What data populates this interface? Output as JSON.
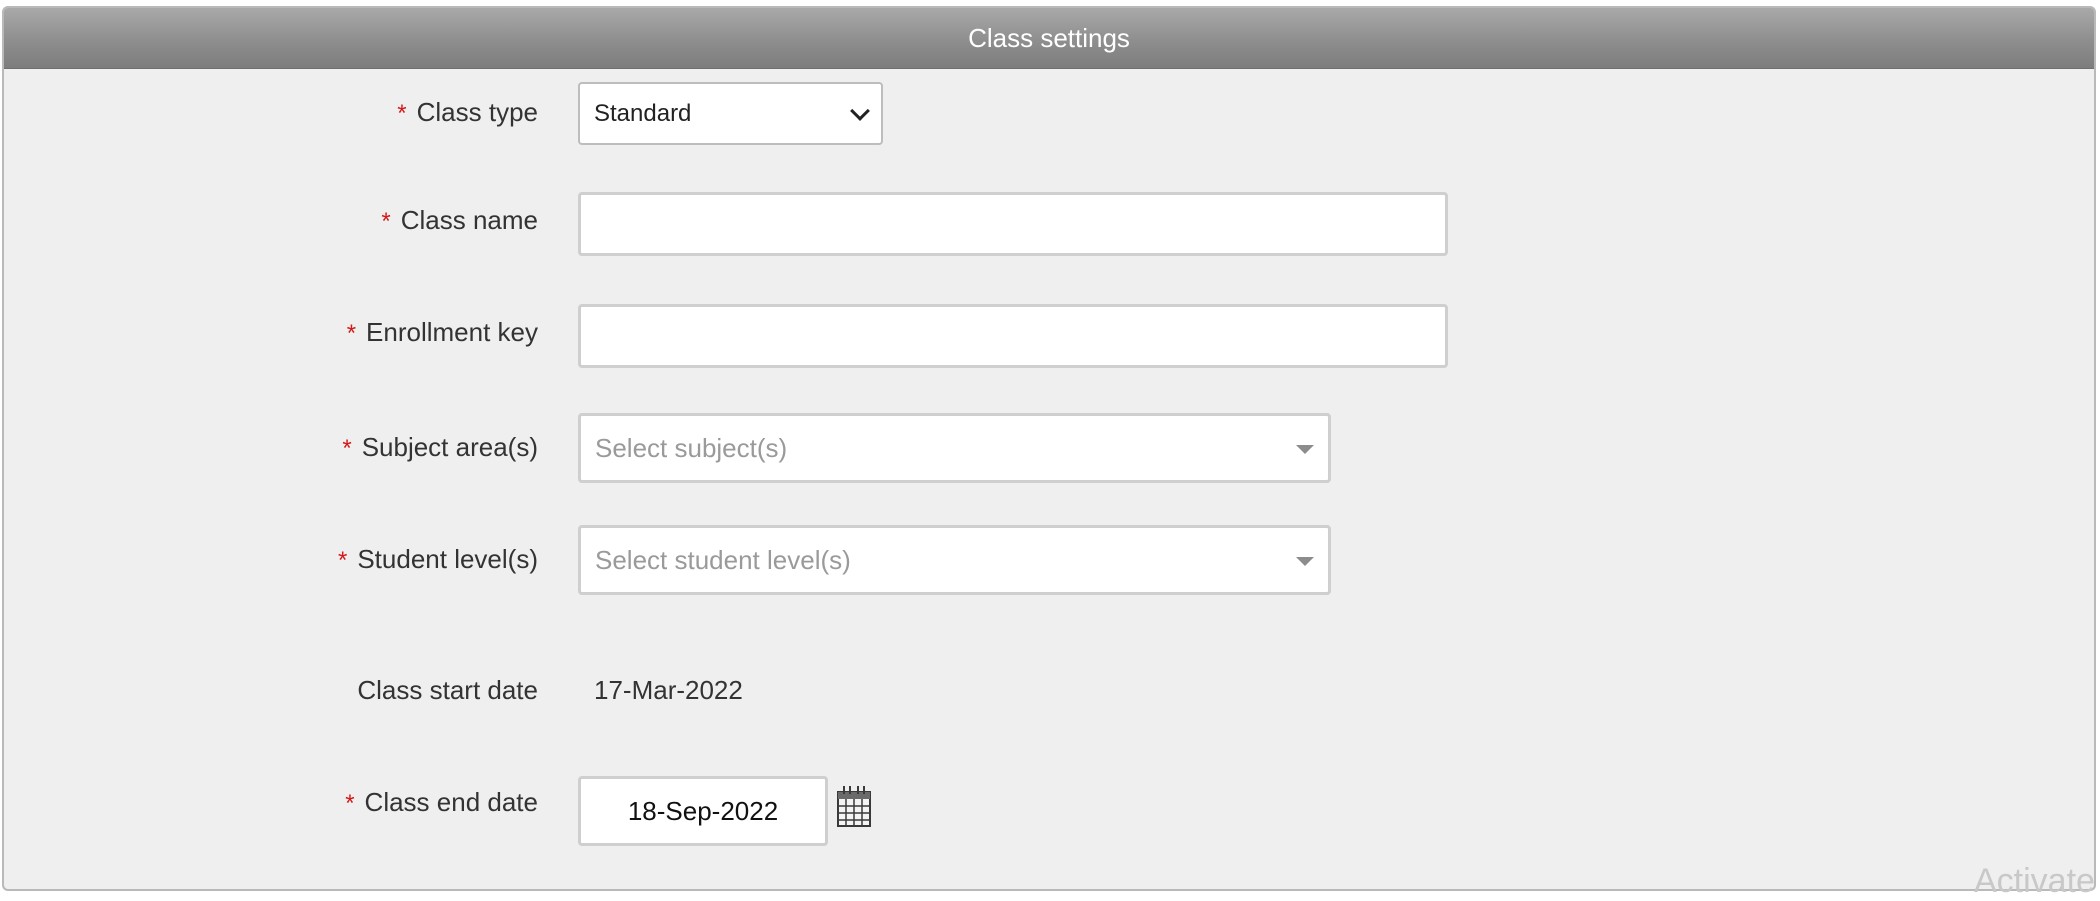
{
  "panel": {
    "title": "Class settings"
  },
  "form": {
    "required_marker": "*",
    "class_type": {
      "label": "Class type",
      "value": "Standard"
    },
    "class_name": {
      "label": "Class name",
      "value": ""
    },
    "enrollment_key": {
      "label": "Enrollment key",
      "value": ""
    },
    "subject_areas": {
      "label": "Subject area(s)",
      "placeholder": "Select subject(s)"
    },
    "student_levels": {
      "label": "Student level(s)",
      "placeholder": "Select student level(s)"
    },
    "class_start_date": {
      "label": "Class start date",
      "value": "17-Mar-2022"
    },
    "class_end_date": {
      "label": "Class end date",
      "value": "18-Sep-2022"
    }
  },
  "icons": {
    "chevron": "chevron-down-icon",
    "dropdown": "triangle-down-icon",
    "calendar": "calendar-icon"
  },
  "colors": {
    "required": "#d31818",
    "header_bg": "#8e8e8e",
    "panel_bg": "#efefef"
  },
  "watermark": {
    "text": "Activate"
  }
}
